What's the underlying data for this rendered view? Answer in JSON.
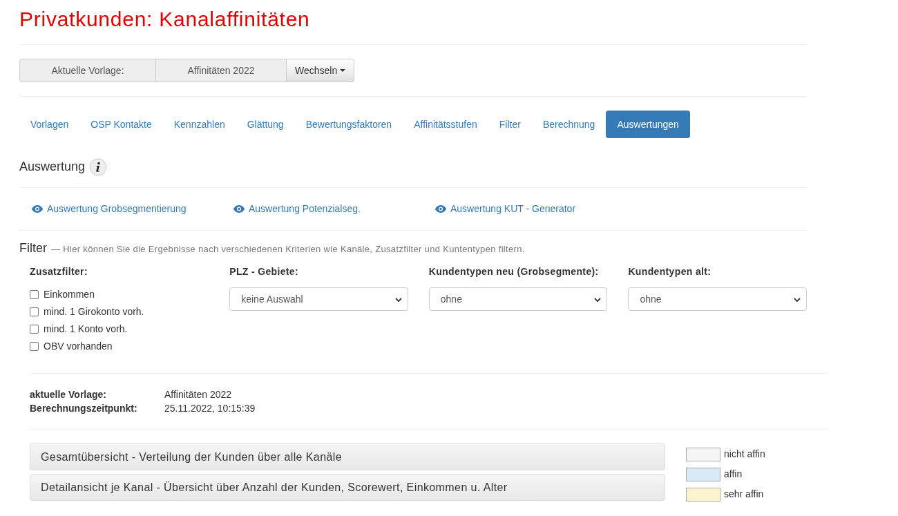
{
  "title": "Privatkunden: Kanalaffinitäten",
  "template_bar": {
    "label": "Aktuelle Vorlage:",
    "value": "Affinitäten 2022",
    "button": "Wechseln"
  },
  "tabs": [
    {
      "label": "Vorlagen",
      "selected": false
    },
    {
      "label": "OSP Kontakte",
      "selected": false
    },
    {
      "label": "Kennzahlen",
      "selected": false
    },
    {
      "label": "Glättung",
      "selected": false
    },
    {
      "label": "Bewertungsfaktoren",
      "selected": false
    },
    {
      "label": "Affinitätsstufen",
      "selected": false
    },
    {
      "label": "Filter",
      "selected": false
    },
    {
      "label": "Berechnung",
      "selected": false
    },
    {
      "label": "Auswertungen",
      "selected": true
    }
  ],
  "section_title": "Auswertung",
  "reports": [
    "Auswertung Grobsegmentierung",
    "Auswertung Potenzialseg.",
    "Auswertung KUT - Generator"
  ],
  "filter": {
    "title": "Filter",
    "description": "— Hier können Sie die Ergebnisse nach verschiedenen Kriterien wie Kanäle, Zusatzfilter und Kuntentypen filtern.",
    "extra_label": "Zusatzfilter:",
    "checkboxes": [
      {
        "label": "Einkommen",
        "checked": false
      },
      {
        "label": "mind. 1 Girokonto vorh.",
        "checked": false
      },
      {
        "label": "mind. 1 Konto vorh.",
        "checked": false
      },
      {
        "label": "OBV vorhanden",
        "checked": false
      }
    ],
    "selects": [
      {
        "label": "PLZ - Gebiete:",
        "value": "keine Auswahl"
      },
      {
        "label": "Kundentypen neu (Grobsegmente):",
        "value": "ohne"
      },
      {
        "label": "Kundentypen alt:",
        "value": "ohne"
      }
    ]
  },
  "info": [
    {
      "label": "aktuelle Vorlage:",
      "value": "Affinitäten 2022"
    },
    {
      "label": "Berechnungszeitpunkt:",
      "value": "25.11.2022, 10:15:39"
    }
  ],
  "panels": [
    "Gesamtübersicht - Verteilung der Kunden über alle Kanäle",
    "Detailansicht je Kanal - Übersicht über Anzahl der Kunden, Scorewert, Einkommen u. Alter"
  ],
  "legend": [
    {
      "label": "nicht affin",
      "color": "#f5f5f5"
    },
    {
      "label": "affin",
      "color": "#d9eaf7"
    },
    {
      "label": "sehr affin",
      "color": "#fcf3cf"
    }
  ]
}
